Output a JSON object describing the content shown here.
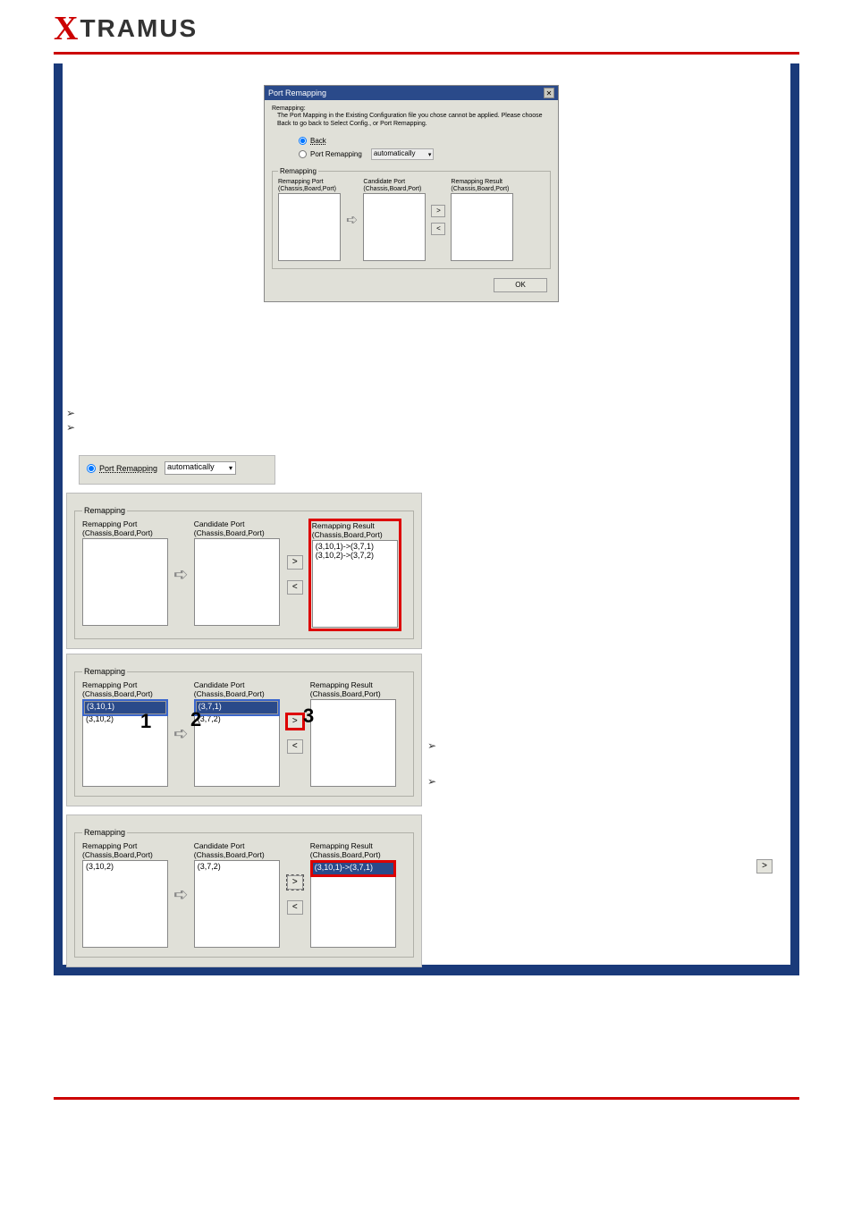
{
  "logo": {
    "x": "X",
    "rest": "TRAMUS"
  },
  "dialog": {
    "title": "Port Remapping",
    "close": "✕",
    "msg_label": "Remapping:",
    "msg_body": "The Port Mapping in the Existing Configuration file you chose cannot be applied. Please choose Back to go back to Select Config., or Port Remapping.",
    "radio_back": "Back",
    "radio_remap": "Port Remapping",
    "select_auto": "automatically",
    "fs_legend": "Remapping",
    "lbl_remap_port": "Remapping Port",
    "lbl_cbp": "(Chassis,Board,Port)",
    "lbl_cand": "Candidate Port",
    "lbl_result": "Remapping Result",
    "gt": ">",
    "lt": "<",
    "ok": "OK",
    "arrow": "➪"
  },
  "panel1": {
    "radio_remap": "Port Remapping",
    "select_auto": "automatically"
  },
  "fs": {
    "legend": "Remapping",
    "lbl_remap_port": "Remapping Port",
    "lbl_cbp": "(Chassis,Board,Port)",
    "lbl_cand": "Candidate Port",
    "lbl_result": "Remapping Result",
    "gt": ">",
    "lt": "<",
    "arrow": "➪"
  },
  "panel2": {
    "result1": "(3,10,1)->(3,7,1)",
    "result2": "(3,10,2)->(3,7,2)"
  },
  "panel3": {
    "remap1": "(3,10,1)",
    "remap2": "(3,10,2)",
    "cand1": "(3,7,1)",
    "cand2": "(3,7,2)",
    "n1": "1",
    "n2": "2",
    "n3": "3"
  },
  "panel4": {
    "remap1": "(3,10,2)",
    "cand1": "(3,7,2)",
    "result1": "(3,10,1)->(3,7,1)"
  },
  "bullets": {
    "a1": "➢",
    "a2": "➢",
    "a3": "➢",
    "a4": "➢",
    "ext_gt": ">"
  },
  "chart_data": null
}
